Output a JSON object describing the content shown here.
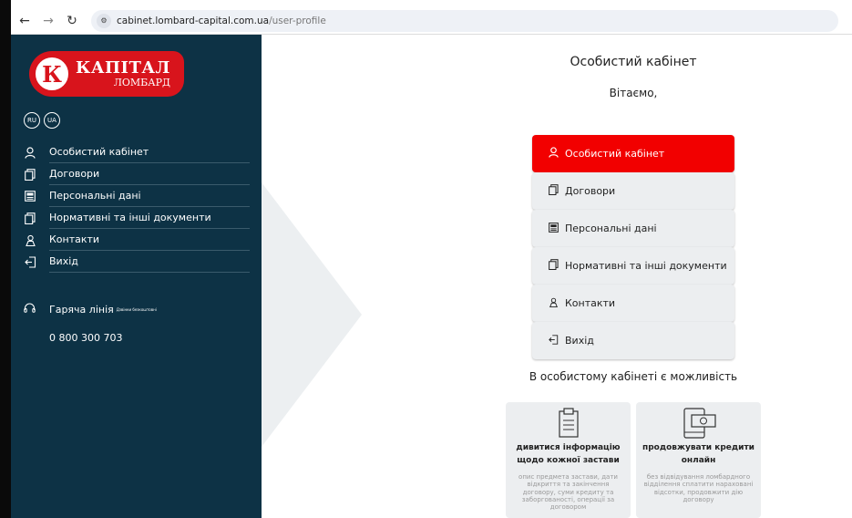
{
  "browser": {
    "url_host": "cabinet.lombard-capital.com.ua",
    "url_path": "/user-profile"
  },
  "logo": {
    "main": "КАПІТАЛ",
    "sub": "ЛОМБАРД",
    "letter": "К"
  },
  "languages": [
    "RU",
    "UA"
  ],
  "sidebar": {
    "items": [
      {
        "label": "Особистий кабінет",
        "icon": "user-icon"
      },
      {
        "label": "Договори",
        "icon": "documents-icon"
      },
      {
        "label": "Персональні дані",
        "icon": "id-card-icon"
      },
      {
        "label": "Нормативні та інші документи",
        "icon": "documents-icon"
      },
      {
        "label": "Контакти",
        "icon": "contacts-icon"
      },
      {
        "label": "Вихід",
        "icon": "logout-icon"
      }
    ],
    "hotline_label": "Гаряча лінія",
    "hotline_note": "Дзвінки безкоштовні",
    "phone": "0 800 300 703"
  },
  "main": {
    "title": "Особистий кабінет",
    "welcome": "Вітаємо,",
    "buttons": [
      {
        "label": "Особистий кабінет",
        "icon": "user-icon",
        "active": true
      },
      {
        "label": "Договори",
        "icon": "documents-icon"
      },
      {
        "label": "Персональні дані",
        "icon": "id-card-icon"
      },
      {
        "label": "Нормативні та інші документи",
        "icon": "documents-icon"
      },
      {
        "label": "Контакти",
        "icon": "contacts-icon"
      },
      {
        "label": "Вихід",
        "icon": "logout-icon"
      }
    ],
    "possibility_title": "В особистому кабінеті є можливість",
    "cards": [
      {
        "title": "дивитися інформацію щодо кожної застави",
        "desc": "опис предмета застави, дати відкриття та закінчення договору, суми кредиту та заборгованості, операції за договором",
        "icon": "clipboard-icon"
      },
      {
        "title": "продовжувати кредити онлайн",
        "desc": "без відвідування ломбардного відділення сплатити нараховані відсотки, продовжити дію договору",
        "icon": "phone-money-icon"
      }
    ]
  },
  "colors": {
    "sidebar_bg": "#0d3245",
    "accent_red": "#f20000",
    "logo_red": "#d8141c"
  }
}
